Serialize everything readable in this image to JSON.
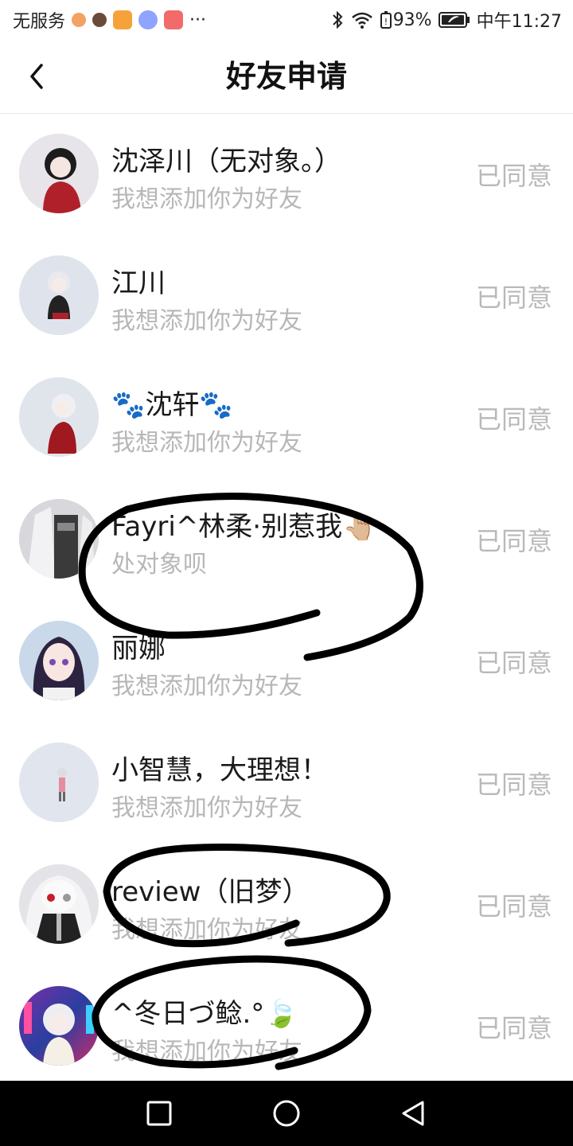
{
  "status_bar": {
    "carrier": "无服务",
    "more": "···",
    "battery": "93%",
    "time": "中午11:27",
    "icons": [
      "notification-icon",
      "notification-icon",
      "video-app-icon",
      "music-app-icon",
      "shopping-app-icon",
      "bluetooth-icon",
      "wifi-icon",
      "battery-icon"
    ]
  },
  "header": {
    "title": "好友申请",
    "back_icon": "chevron-left-icon"
  },
  "requests": [
    {
      "name": "沈泽川（无对象。）",
      "message": "我想添加你为好友",
      "status": "已同意",
      "avatar_color": "#b0202a"
    },
    {
      "name": "江川",
      "message": "我想添加你为好友",
      "status": "已同意",
      "avatar_color": "#2a2a2a"
    },
    {
      "name_prefix": "🐾",
      "name": "沈轩",
      "name_suffix": "🐾",
      "message": "我想添加你为好友",
      "status": "已同意",
      "avatar_color": "#a01820"
    },
    {
      "name": "Fayri^林柔·别惹我",
      "name_suffix": "👆🏼",
      "message": "处对象呗",
      "status": "已同意",
      "avatar_color": "#4a4a4a"
    },
    {
      "name": "丽娜",
      "message": "我想添加你为好友",
      "status": "已同意",
      "avatar_color": "#2c2340"
    },
    {
      "name": "小智慧，大理想！",
      "message": "我想添加你为好友",
      "status": "已同意",
      "avatar_color": "#7a6a7a"
    },
    {
      "name": "review（旧梦）",
      "message": "我想添加你为好友",
      "status": "已同意",
      "avatar_color": "#222222"
    },
    {
      "name": "^冬日づ鲶.°",
      "name_suffix": "🍃",
      "message": "我想添加你为好友",
      "status": "已同意",
      "avatar_color": "#5a3a9a"
    }
  ],
  "colors": {
    "text_primary": "#1a1a1a",
    "text_secondary": "#b7b7b7",
    "divider": "#e8e8e8",
    "nav_bar": "#000000"
  },
  "system_nav": {
    "icons": [
      "recents-square-icon",
      "home-circle-icon",
      "back-triangle-icon"
    ]
  }
}
